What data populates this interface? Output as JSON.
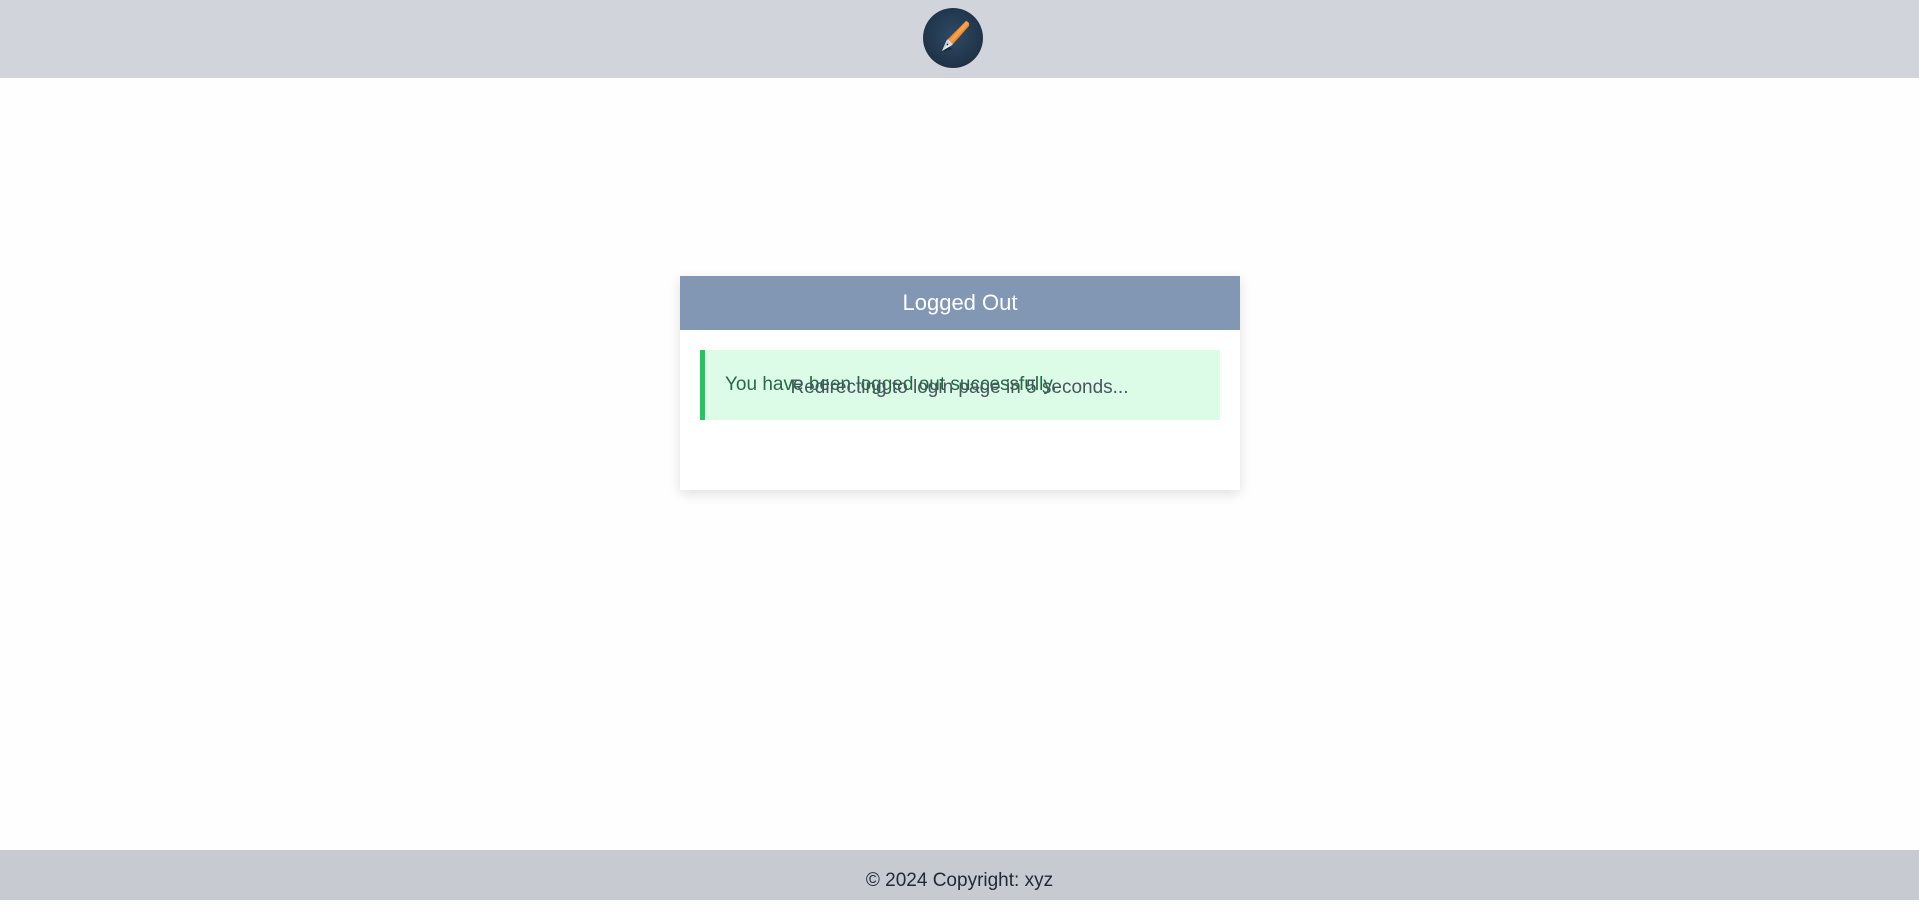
{
  "header": {
    "logo_icon": "fountain-pen-icon"
  },
  "card": {
    "title": "Logged Out",
    "alert_message": "You have been logged out successfully.",
    "redirect_text": "Redirecting to login page in 5 seconds..."
  },
  "footer": {
    "copyright": "© 2024 Copyright: xyz"
  },
  "colors": {
    "header_bg": "#d1d5db",
    "card_header_bg": "#8297b3",
    "alert_bg": "#dcfce7",
    "alert_border": "#22c55e",
    "alert_text": "#226b44",
    "footer_bg": "#c7cad0"
  }
}
